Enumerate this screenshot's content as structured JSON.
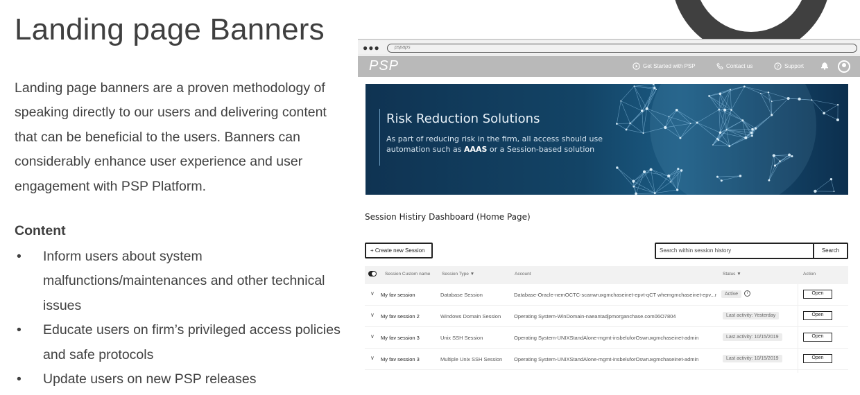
{
  "slide": {
    "title": "Landing page Banners",
    "description": "Landing page banners are a proven methodology of speaking directly to our users and delivering content that can be beneficial to the users. Banners can considerably enhance user experience and user engagement with PSP Platform.",
    "content_heading": "Content",
    "bullet_glyph": "•",
    "bullets": [
      "Inform users about system malfunctions/maintenances and other technical issues",
      "Educate users on firm’s privileged access policies and safe protocols",
      "Update users on new PSP releases"
    ]
  },
  "mockup": {
    "browser": {
      "dots": "●●●",
      "url": "pspaps"
    },
    "header": {
      "logo": "PSP",
      "nav": [
        {
          "label": "Get Started with PSP",
          "icon": "play-circle-icon"
        },
        {
          "label": "Contact us",
          "icon": "phone-icon"
        },
        {
          "label": "Support",
          "icon": "help-circle-icon"
        }
      ],
      "bell_icon": "bell-icon",
      "avatar_icon": "user-avatar-icon"
    },
    "banner": {
      "title": "Risk Reduction Solutions",
      "text_before": "As part of reducing risk in the firm, all access should use automation such as ",
      "text_bold": "AAAS",
      "text_after": " or a Session-based solution",
      "colors": {
        "background": "#134466",
        "accent": "#6b9bbf",
        "network": "#9fd3f5"
      }
    },
    "dashboard": {
      "title": "Session Histiry Dashboard (Home Page)",
      "create_button": "+ Create new Session",
      "search_placeholder": "Search within session history",
      "search_button": "Search",
      "columns": {
        "name": "Session Custom name",
        "type": "Session Type",
        "account": "Account",
        "status": "Status",
        "action": "Action"
      },
      "rows": [
        {
          "name": "My fav session",
          "type": "Database Session",
          "account": "Database-Oracle-nemOCTC-scanwruxgmchaseinet-epvt-qCT whemgmchaseinet-epv...ns",
          "status": "Active",
          "action": "Open",
          "has_info": true
        },
        {
          "name": "My fav session 2",
          "type": "Windows Domain Session",
          "account": "Operating System-WinDomain-naeantadjpmorganchase.com06O7804",
          "status": "Last activity: Yesterday",
          "action": "Open",
          "has_info": false
        },
        {
          "name": "My fav session 3",
          "type": "Unix SSH Session",
          "account": "Operating System-UNIXStandAlone-mgmt-insbeluforOswruxgmchaseinet-admin",
          "status": "Last activity: 10/15/2019",
          "action": "Open",
          "has_info": false
        },
        {
          "name": "My fav session 3",
          "type": "Multiple Unix SSH Session",
          "account": "Operating System-UNIXStandAlone-mgmt-insbeluforOswruxgmchaseinet-admin",
          "status": "Last activity: 10/15/2019",
          "action": "Open",
          "has_info": false
        }
      ]
    }
  }
}
